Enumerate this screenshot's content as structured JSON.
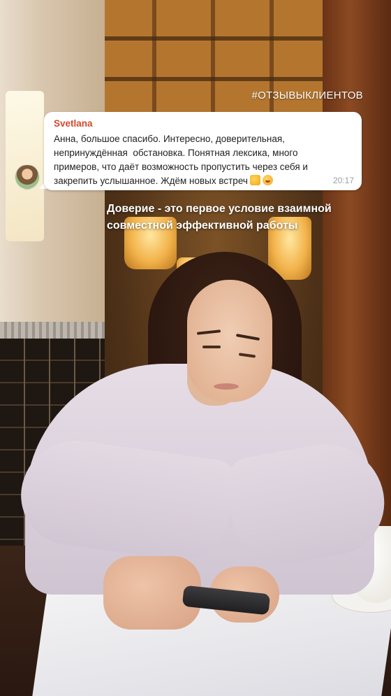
{
  "story": {
    "hashtag": "#ОТЗЫВЫКЛИЕНТОВ",
    "review": {
      "sender": "Svetlana",
      "lines": [
        "Анна, большое спасибо. Интересно, доверительная,",
        "непринуждённая  обстановка. Понятная лексика, много",
        "примеров, что даёт возможность пропустить через себя и",
        "закрепить услышанное. Ждём новых встреч"
      ],
      "emoji": [
        "thumbs-up-emoji",
        "smiling-face-emoji"
      ],
      "time": "20:17"
    },
    "caption": {
      "line1": "Доверие - это первое условие взаимной",
      "line2": "совместной эффективной работы"
    }
  },
  "colors": {
    "sender": "#d6472b",
    "bubble": "#ffffff",
    "caption": "#ffffff"
  }
}
